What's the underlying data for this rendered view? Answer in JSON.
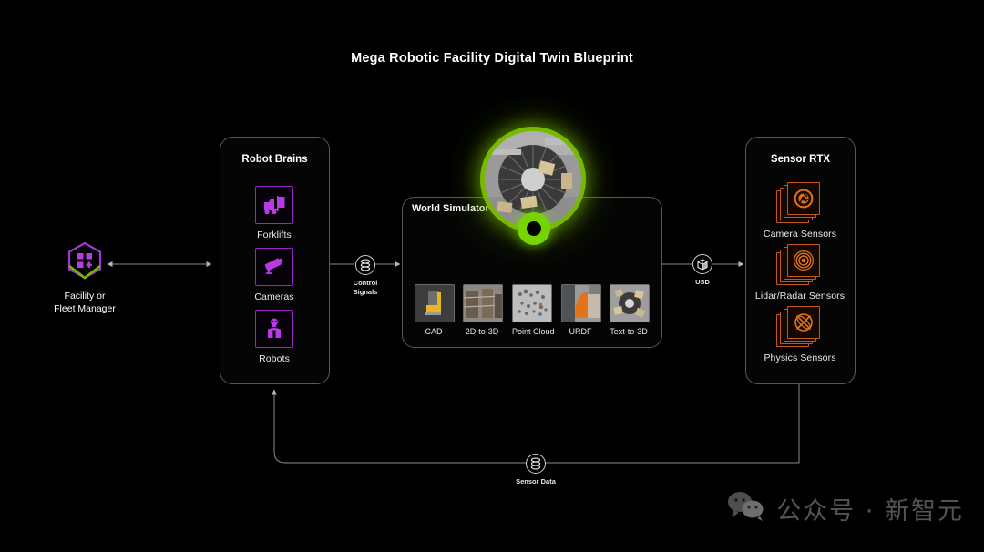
{
  "page": {
    "title": "Mega Robotic Facility Digital Twin Blueprint",
    "background_color": "#000000",
    "accent_green": "#76b900",
    "accent_purple": "#9b26c4",
    "accent_orange": "#c2591f"
  },
  "facility": {
    "label_line1": "Facility or",
    "label_line2": "Fleet Manager",
    "icon": "hexagon-plus-icon"
  },
  "robot_brains": {
    "title": "Robot Brains",
    "items": [
      {
        "label": "Forklifts",
        "icon": "forklift-icon"
      },
      {
        "label": "Cameras",
        "icon": "security-camera-icon"
      },
      {
        "label": "Robots",
        "icon": "humanoid-robot-icon"
      }
    ]
  },
  "world_simulator": {
    "title": "World Simulator",
    "hero_icon": "warehouse-top-down-render",
    "torus_icon": "green-torus-icon",
    "sources": [
      {
        "label": "CAD",
        "icon": "cad-thumbnail"
      },
      {
        "label": "2D-to-3D",
        "icon": "2d-to-3d-thumbnail"
      },
      {
        "label": "Point Cloud",
        "icon": "point-cloud-thumbnail"
      },
      {
        "label": "URDF",
        "icon": "urdf-thumbnail"
      },
      {
        "label": "Text-to-3D",
        "icon": "text-to-3d-thumbnail"
      }
    ]
  },
  "sensor_rtx": {
    "title": "Sensor RTX",
    "items": [
      {
        "label": "Camera Sensors",
        "icon": "aperture-icon"
      },
      {
        "label": "Lidar/Radar Sensors",
        "icon": "radar-waves-icon"
      },
      {
        "label": "Physics Sensors",
        "icon": "physics-orbit-icon"
      }
    ]
  },
  "connectors": [
    {
      "id": "control-signals",
      "label_line1": "Control",
      "label_line2": "Signals",
      "icon": "data-stack-icon"
    },
    {
      "id": "usd",
      "label_line1": "USD",
      "label_line2": "",
      "icon": "cube-icon"
    },
    {
      "id": "sensor-data",
      "label_line1": "Sensor Data",
      "label_line2": "",
      "icon": "data-stack-icon"
    }
  ],
  "watermark": {
    "icon": "wechat-icon",
    "text": "公众号 · 新智元"
  }
}
